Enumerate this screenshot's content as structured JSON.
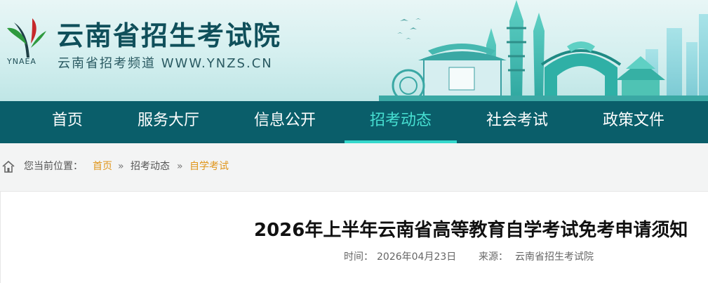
{
  "header": {
    "logo_abbr": "YNAEA",
    "site_title": "云南省招生考试院",
    "site_subtitle": "云南省招考频道 WWW.YNZS.CN",
    "colors": {
      "brand_teal": "#0a5e6a",
      "brand_green": "#2e9a3e",
      "brand_red": "#c6282b"
    }
  },
  "nav": {
    "items": [
      {
        "label": "首页"
      },
      {
        "label": "服务大厅"
      },
      {
        "label": "信息公开"
      },
      {
        "label": "招考动态",
        "active": true
      },
      {
        "label": "社会考试"
      },
      {
        "label": "政策文件"
      }
    ],
    "active_color": "#47e0d2"
  },
  "breadcrumb": {
    "icon": "home-icon",
    "prefix": "您当前位置：",
    "home": "首页",
    "sep": "»",
    "section": "招考动态",
    "current": "自学考试",
    "link_color": "#e0961c"
  },
  "article": {
    "title": "2026年上半年云南省高等教育自学考试免考申请须知",
    "time_label": "时间：",
    "time_value": "2026年04月23日",
    "source_label": "来源：",
    "source_value": "云南省招生考试院"
  }
}
